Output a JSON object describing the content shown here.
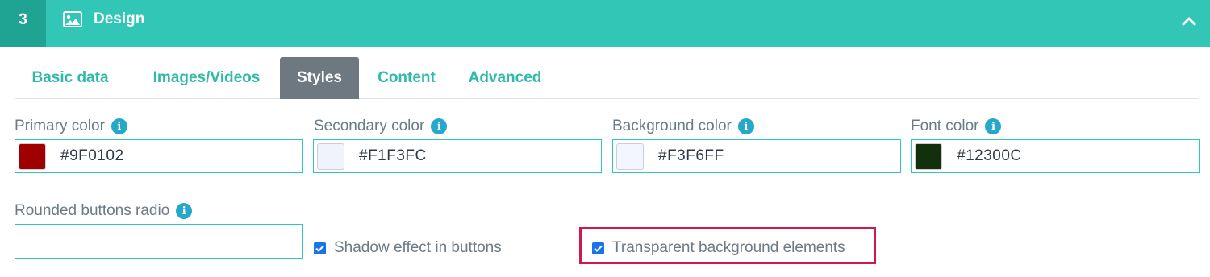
{
  "header": {
    "step": "3",
    "title": "Design",
    "icon": "image-icon",
    "collapse_icon": "chevron-up-icon"
  },
  "tabs": [
    {
      "label": "Basic data",
      "active": false
    },
    {
      "label": "Images/Videos",
      "active": false
    },
    {
      "label": "Styles",
      "active": true
    },
    {
      "label": "Content",
      "active": false
    },
    {
      "label": "Advanced",
      "active": false
    }
  ],
  "colors": [
    {
      "label": "Primary color",
      "value": "#9F0102",
      "swatch": "#9F0102"
    },
    {
      "label": "Secondary color",
      "value": "#F1F3FC",
      "swatch": "#F1F3FC"
    },
    {
      "label": "Background color",
      "value": "#F3F6FF",
      "swatch": "#F3F6FF"
    },
    {
      "label": "Font color",
      "value": "#12300C",
      "swatch": "#12300C"
    }
  ],
  "rounded": {
    "label": "Rounded buttons radio",
    "value": ""
  },
  "checkboxes": [
    {
      "label": "Shadow effect in buttons",
      "checked": true
    },
    {
      "label": "Transparent background elements",
      "checked": true,
      "highlighted": true
    }
  ],
  "theme": {
    "accent": "#31C6B5",
    "step_bg": "#1FA393",
    "active_tab": "#6E7880",
    "info": "#25A8C9",
    "highlight": "#D0174E"
  }
}
